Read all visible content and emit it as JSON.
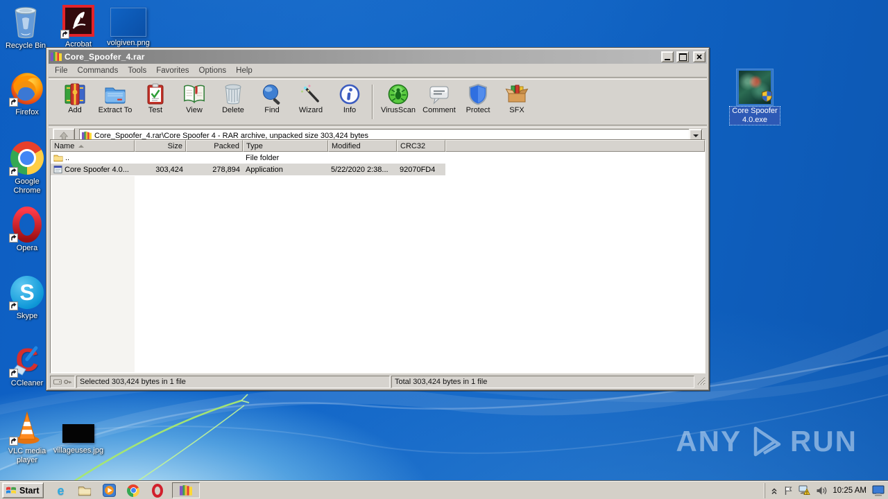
{
  "desktop": {
    "icons": [
      {
        "id": "recycle-bin",
        "label": "Recycle Bin"
      },
      {
        "id": "acrobat",
        "label": "Acrobat"
      },
      {
        "id": "volgiven",
        "label": "volgiven.png"
      },
      {
        "id": "firefox",
        "label": "Firefox"
      },
      {
        "id": "google-chrome",
        "label": "Google Chrome"
      },
      {
        "id": "opera",
        "label": "Opera"
      },
      {
        "id": "skype",
        "label": "Skype"
      },
      {
        "id": "ccleaner",
        "label": "CCleaner"
      },
      {
        "id": "vlc",
        "label": "VLC media player"
      },
      {
        "id": "villageuses",
        "label": "villageuses.jpg"
      },
      {
        "id": "core-spoofer",
        "label": "Core Spoofer 4.0.exe",
        "selected": true
      }
    ],
    "watermark": {
      "left": "ANY",
      "right": "RUN"
    }
  },
  "glyphs": {
    "skype": "S",
    "ccleaner": "C",
    "ie": "e"
  },
  "window": {
    "title": "Core_Spoofer_4.rar",
    "menu": [
      "File",
      "Commands",
      "Tools",
      "Favorites",
      "Options",
      "Help"
    ],
    "toolbar": [
      {
        "icon": "add-archive-icon",
        "label": "Add"
      },
      {
        "icon": "extract-to-icon",
        "label": "Extract To"
      },
      {
        "icon": "test-icon",
        "label": "Test"
      },
      {
        "icon": "view-icon",
        "label": "View"
      },
      {
        "icon": "delete-icon",
        "label": "Delete"
      },
      {
        "icon": "find-icon",
        "label": "Find"
      },
      {
        "icon": "wizard-icon",
        "label": "Wizard"
      },
      {
        "icon": "info-icon",
        "label": "Info"
      },
      {
        "icon": "virusscan-icon",
        "label": "VirusScan"
      },
      {
        "icon": "comment-icon",
        "label": "Comment"
      },
      {
        "icon": "protect-icon",
        "label": "Protect"
      },
      {
        "icon": "sfx-icon",
        "label": "SFX"
      }
    ],
    "address": "Core_Spoofer_4.rar\\Core Spoofer 4 - RAR archive, unpacked size 303,424 bytes",
    "columns": [
      "Name",
      "Size",
      "Packed",
      "Type",
      "Modified",
      "CRC32"
    ],
    "rows": [
      {
        "name": "..",
        "size": "",
        "packed": "",
        "type": "File folder",
        "modified": "",
        "crc32": ""
      },
      {
        "name": "Core Spoofer 4.0...",
        "size": "303,424",
        "packed": "278,894",
        "type": "Application",
        "modified": "5/22/2020 2:38...",
        "crc32": "92070FD4",
        "selected": true
      }
    ],
    "statusbar": {
      "selected": "Selected 303,424 bytes in 1 file",
      "total": "Total 303,424 bytes in 1 file"
    }
  },
  "taskbar": {
    "start_label": "Start",
    "clock": "10:25 AM"
  },
  "colors": {
    "desktop_blue": "#1063c4",
    "titlebar_inactive": "#8a8a8a",
    "window_face": "#d6d3ce",
    "selection_inactive": "#d9d7d3",
    "desktop_selected_label": "#2d59b5",
    "taskbar": "#d4d0c8"
  }
}
